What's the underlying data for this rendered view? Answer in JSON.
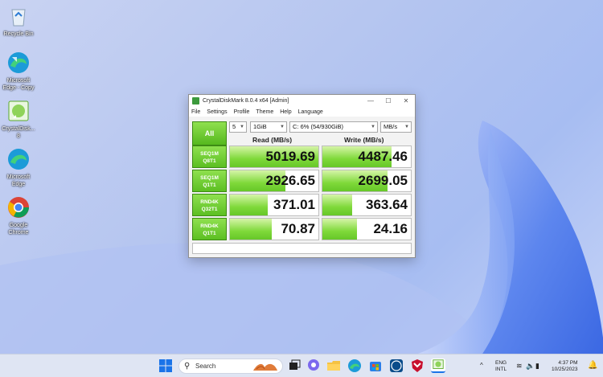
{
  "desktop": {
    "icons": [
      {
        "label": "Recycle Bin"
      },
      {
        "label": "Microsoft Edge - Copy"
      },
      {
        "label": "CrystalDisk... 8"
      },
      {
        "label": "Microsoft Edge"
      },
      {
        "label": "Google Chrome"
      }
    ]
  },
  "window": {
    "title": "CrystalDiskMark 8.0.4 x64 [Admin]",
    "menu": [
      "File",
      "Settings",
      "Profile",
      "Theme",
      "Help",
      "Language"
    ],
    "all_label": "All",
    "count": "5",
    "size": "1GiB",
    "drive": "C: 6% (54/930GiB)",
    "unit": "MB/s",
    "read_header": "Read (MB/s)",
    "write_header": "Write (MB/s)",
    "rows": [
      {
        "label1": "SEQ1M",
        "label2": "Q8T1",
        "read": "5019.69",
        "write": "4487.46",
        "read_fill": 1.0,
        "write_fill": 0.78
      },
      {
        "label1": "SEQ1M",
        "label2": "Q1T1",
        "read": "2926.65",
        "write": "2699.05",
        "read_fill": 0.63,
        "write_fill": 0.74
      },
      {
        "label1": "RND4K",
        "label2": "Q32T1",
        "read": "371.01",
        "write": "363.64",
        "read_fill": 0.43,
        "write_fill": 0.34
      },
      {
        "label1": "RND4K",
        "label2": "Q1T1",
        "read": "70.87",
        "write": "24.16",
        "read_fill": 0.47,
        "write_fill": 0.39
      }
    ]
  },
  "taskbar": {
    "search_placeholder": "Search",
    "lang1": "ENG",
    "lang2": "INTL",
    "time": "4:37 PM",
    "date": "10/25/2023"
  },
  "colors": {
    "accent_green": "#5cbf22",
    "taskbar_bg": "#dfe5f3"
  }
}
